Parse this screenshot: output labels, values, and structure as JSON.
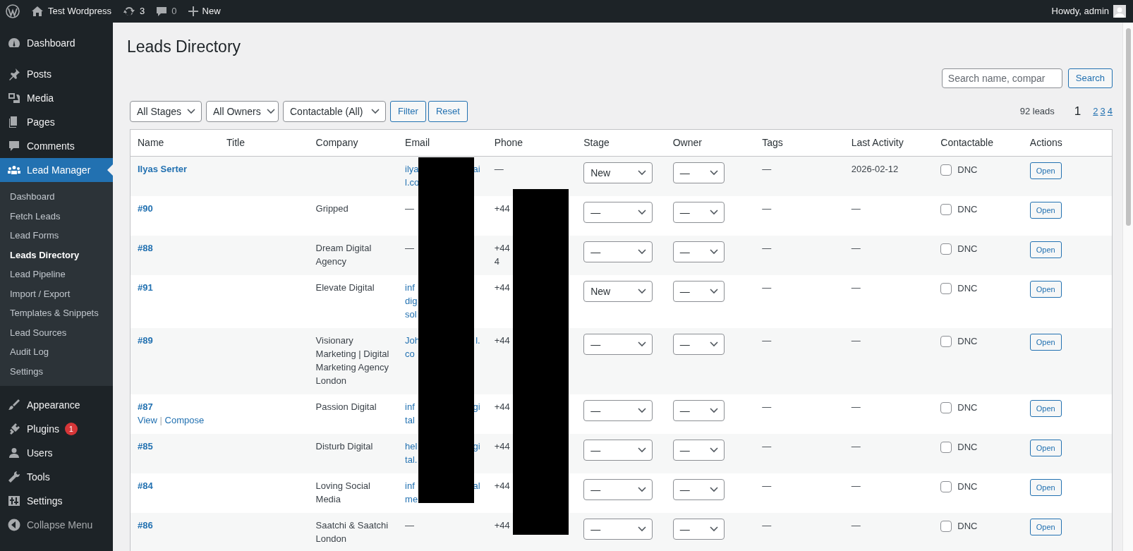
{
  "admin_bar": {
    "site": "Test Wordpress",
    "updates": "3",
    "comments": "0",
    "new_label": "New",
    "greeting": "Howdy, admin"
  },
  "sidebar": {
    "items": [
      {
        "label": "Dashboard",
        "selected": false
      },
      {
        "label": "Posts",
        "selected": false
      },
      {
        "label": "Media",
        "selected": false
      },
      {
        "label": "Pages",
        "selected": false
      },
      {
        "label": "Comments",
        "selected": false
      },
      {
        "label": "Lead Manager",
        "selected": true,
        "children": [
          {
            "label": "Dashboard",
            "selected": false
          },
          {
            "label": "Fetch Leads",
            "selected": false
          },
          {
            "label": "Lead Forms",
            "selected": false
          },
          {
            "label": "Leads Directory",
            "selected": true
          },
          {
            "label": "Lead Pipeline",
            "selected": false
          },
          {
            "label": "Import / Export",
            "selected": false
          },
          {
            "label": "Templates & Snippets",
            "selected": false
          },
          {
            "label": "Lead Sources",
            "selected": false
          },
          {
            "label": "Audit Log",
            "selected": false
          },
          {
            "label": "Settings",
            "selected": false
          }
        ]
      },
      {
        "label": "Appearance",
        "selected": false
      },
      {
        "label": "Plugins",
        "selected": false,
        "badge": "1"
      },
      {
        "label": "Users",
        "selected": false
      },
      {
        "label": "Tools",
        "selected": false
      },
      {
        "label": "Settings",
        "selected": false
      }
    ],
    "collapse_label": "Collapse Menu"
  },
  "page": {
    "title": "Leads Directory",
    "search": {
      "placeholder": "Search name, compar",
      "button": "Search"
    },
    "filters": [
      "All Stages",
      "All Owners",
      "Contactable (All)"
    ],
    "filter_button": "Filter",
    "reset_button": "Reset",
    "count": "92 leads",
    "pages": [
      {
        "label": "1",
        "selected": true
      },
      {
        "label": "2",
        "selected": false
      },
      {
        "label": "3",
        "selected": false
      },
      {
        "label": "4",
        "selected": false
      }
    ]
  },
  "table": {
    "columns": [
      "Name",
      "Title",
      "Company",
      "Email",
      "Phone",
      "Stage",
      "Owner",
      "Tags",
      "Last Activity",
      "Contactable",
      "Actions"
    ],
    "rows": [
      {
        "name": "Ilyas Serter",
        "company": "",
        "email": [
          {
            "start": "ilya",
            "end": "ai"
          },
          {
            "start": "l.co"
          }
        ],
        "phone": [
          {
            "start": "—"
          }
        ],
        "stage": "New",
        "owner": "—",
        "tags": "—",
        "last_activity": "2026-02-12",
        "dnc_label": "DNC",
        "dnc_checked": false,
        "action": "Open"
      },
      {
        "name": "#90",
        "company": "Gripped",
        "email": [
          {
            "start": "—"
          }
        ],
        "phone": [
          {
            "start": "+44"
          }
        ],
        "stage": "—",
        "owner": "—",
        "tags": "—",
        "last_activity": "—",
        "dnc_label": "DNC",
        "dnc_checked": false,
        "action": "Open"
      },
      {
        "name": "#88",
        "company": "Dream Digital Agency",
        "email": [
          {
            "start": "—"
          }
        ],
        "phone": [
          {
            "start": "+44"
          },
          {
            "start": "4"
          }
        ],
        "stage": "—",
        "owner": "—",
        "tags": "—",
        "last_activity": "—",
        "dnc_label": "DNC",
        "dnc_checked": false,
        "action": "Open"
      },
      {
        "name": "#91",
        "company": "Elevate Digital",
        "email": [
          {
            "start": "inf"
          },
          {
            "start": "dig"
          },
          {
            "start": "sol"
          }
        ],
        "phone": [
          {
            "start": "+44"
          }
        ],
        "stage": "New",
        "owner": "—",
        "tags": "—",
        "last_activity": "—",
        "dnc_label": "DNC",
        "dnc_checked": false,
        "action": "Open"
      },
      {
        "name": "#89",
        "company": "Visionary Marketing | Digital Marketing Agency London",
        "email": [
          {
            "start": "Joh",
            "end": "l."
          },
          {
            "start": "co"
          }
        ],
        "phone": [
          {
            "start": "+44"
          }
        ],
        "stage": "—",
        "owner": "—",
        "tags": "—",
        "last_activity": "—",
        "dnc_label": "DNC",
        "dnc_checked": false,
        "action": "Open"
      },
      {
        "name": "#87",
        "row_actions": [
          "View",
          "Compose"
        ],
        "row_action_separator": "|",
        "company": "Passion Digital",
        "email": [
          {
            "start": "inf",
            "end": "gi"
          },
          {
            "start": "tal"
          }
        ],
        "phone": [
          {
            "start": "+44"
          }
        ],
        "stage": "—",
        "owner": "—",
        "tags": "—",
        "last_activity": "—",
        "dnc_label": "DNC",
        "dnc_checked": false,
        "action": "Open"
      },
      {
        "name": "#85",
        "company": "Disturb Digital",
        "email": [
          {
            "start": "hel",
            "end": "gi"
          },
          {
            "start": "tal."
          }
        ],
        "phone": [
          {
            "start": "+44"
          }
        ],
        "stage": "—",
        "owner": "—",
        "tags": "—",
        "last_activity": "—",
        "dnc_label": "DNC",
        "dnc_checked": false,
        "action": "Open"
      },
      {
        "name": "#84",
        "company": "Loving Social Media",
        "email": [
          {
            "start": "inf",
            "end": "al"
          },
          {
            "start": "me"
          }
        ],
        "phone": [
          {
            "start": "+44"
          }
        ],
        "stage": "—",
        "owner": "—",
        "tags": "—",
        "last_activity": "—",
        "dnc_label": "DNC",
        "dnc_checked": false,
        "action": "Open"
      },
      {
        "name": "#86",
        "company": "Saatchi & Saatchi London",
        "email": [
          {
            "start": "—"
          }
        ],
        "phone": [
          {
            "start": "+44"
          }
        ],
        "stage": "—",
        "owner": "—",
        "tags": "—",
        "last_activity": "—",
        "dnc_label": "DNC",
        "dnc_checked": false,
        "action": "Open"
      }
    ]
  }
}
